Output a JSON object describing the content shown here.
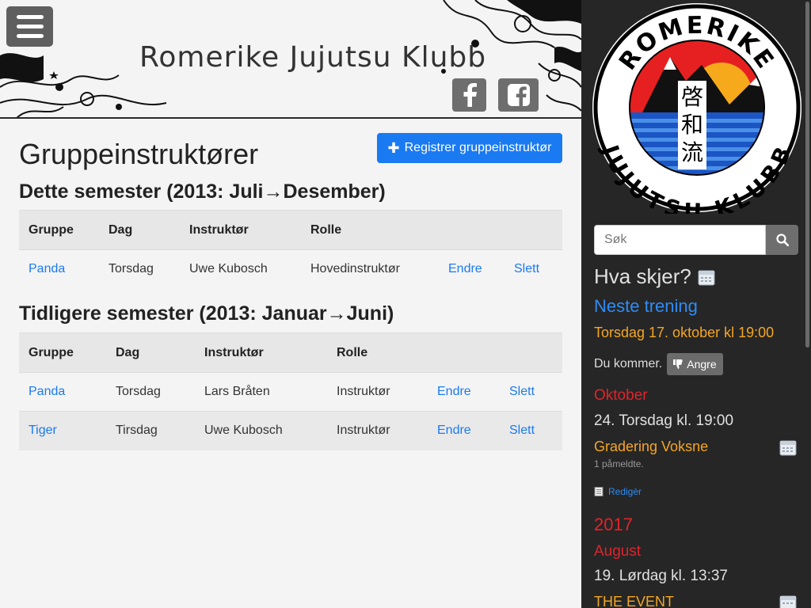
{
  "header": {
    "site_title": "Romerike Jujutsu Klubb",
    "menu_icon": "hamburger-menu-icon",
    "social": [
      {
        "name": "facebook-icon"
      },
      {
        "name": "facebook-square-icon"
      }
    ]
  },
  "main": {
    "page_title": "Gruppeinstruktører",
    "register_button": "Registrer gruppeinstruktør",
    "current": {
      "title": "Dette semester (2013: Juli→Desember)",
      "columns": [
        "Gruppe",
        "Dag",
        "Instruktør",
        "Rolle"
      ],
      "rows": [
        {
          "gruppe": "Panda",
          "dag": "Torsdag",
          "instruktor": "Uwe Kubosch",
          "rolle": "Hovedinstruktør",
          "edit": "Endre",
          "delete": "Slett"
        }
      ]
    },
    "previous": {
      "title": "Tidligere semester (2013: Januar→Juni)",
      "columns": [
        "Gruppe",
        "Dag",
        "Instruktør",
        "Rolle"
      ],
      "rows": [
        {
          "gruppe": "Panda",
          "dag": "Torsdag",
          "instruktor": "Lars Bråten",
          "rolle": "Instruktør",
          "edit": "Endre",
          "delete": "Slett"
        },
        {
          "gruppe": "Tiger",
          "dag": "Tirsdag",
          "instruktor": "Uwe Kubosch",
          "rolle": "Instruktør",
          "edit": "Endre",
          "delete": "Slett"
        }
      ]
    }
  },
  "sidebar": {
    "logo_top": "ROMERIKE",
    "logo_bottom": "JUJUTSU KLUBB",
    "logo_kanji": [
      "啓",
      "和",
      "流"
    ],
    "search_placeholder": "Søk",
    "heading": "Hva skjer?",
    "next_training_label": "Neste trening",
    "next_training_time": "Torsdag 17. oktober kl 19:00",
    "attending_text": "Du kommer.",
    "undo_button": "Angre",
    "events": {
      "month1": "Oktober",
      "ev1_date": "24. Torsdag kl. 19:00",
      "ev1_title": "Gradering Voksne",
      "ev1_count": "1 påmeldte.",
      "ev1_edit": "Redigèr",
      "year": "2017",
      "month2": "August",
      "ev2_date": "19. Lørdag kl. 13:37",
      "ev2_title": "THE EVENT"
    },
    "colors": {
      "accent_blue": "#1a7af2",
      "accent_orange": "#f5a623",
      "accent_red": "#e0242b",
      "sidebar_bg": "#262626"
    }
  }
}
